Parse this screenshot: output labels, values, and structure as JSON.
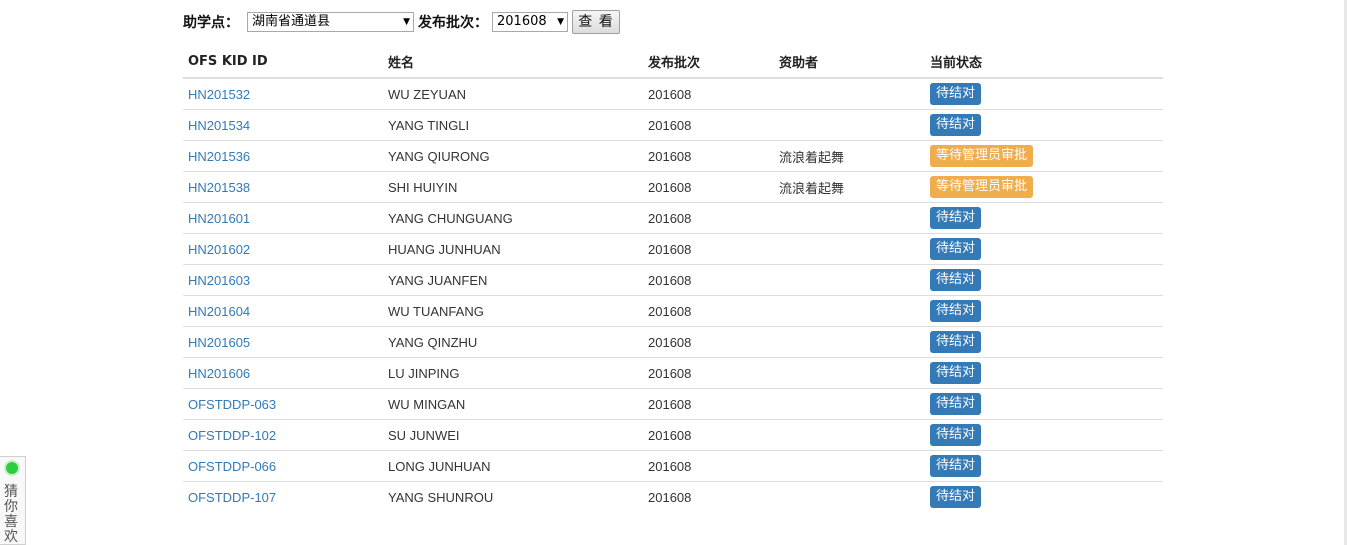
{
  "filters": {
    "site_label": "助学点：",
    "site_value": "湖南省通道县",
    "batch_label": "发布批次：",
    "batch_value": "201608",
    "view_button": "查 看"
  },
  "table": {
    "headers": [
      "OFS KID ID",
      "姓名",
      "发布批次",
      "资助者",
      "当前状态"
    ],
    "rows": [
      {
        "id": "HN201532",
        "name": "WU ZEYUAN",
        "batch": "201608",
        "sponsor": "",
        "status": "待结对",
        "status_kind": "primary"
      },
      {
        "id": "HN201534",
        "name": "YANG TINGLI",
        "batch": "201608",
        "sponsor": "",
        "status": "待结对",
        "status_kind": "primary"
      },
      {
        "id": "HN201536",
        "name": "YANG QIURONG",
        "batch": "201608",
        "sponsor": "流浪着起舞",
        "status": "等待管理员审批",
        "status_kind": "warning"
      },
      {
        "id": "HN201538",
        "name": "SHI HUIYIN",
        "batch": "201608",
        "sponsor": "流浪着起舞",
        "status": "等待管理员审批",
        "status_kind": "warning"
      },
      {
        "id": "HN201601",
        "name": "YANG CHUNGUANG",
        "batch": "201608",
        "sponsor": "",
        "status": "待结对",
        "status_kind": "primary"
      },
      {
        "id": "HN201602",
        "name": "HUANG JUNHUAN",
        "batch": "201608",
        "sponsor": "",
        "status": "待结对",
        "status_kind": "primary"
      },
      {
        "id": "HN201603",
        "name": "YANG JUANFEN",
        "batch": "201608",
        "sponsor": "",
        "status": "待结对",
        "status_kind": "primary"
      },
      {
        "id": "HN201604",
        "name": "WU TUANFANG",
        "batch": "201608",
        "sponsor": "",
        "status": "待结对",
        "status_kind": "primary"
      },
      {
        "id": "HN201605",
        "name": "YANG QINZHU",
        "batch": "201608",
        "sponsor": "",
        "status": "待结对",
        "status_kind": "primary"
      },
      {
        "id": "HN201606",
        "name": "LU JINPING",
        "batch": "201608",
        "sponsor": "",
        "status": "待结对",
        "status_kind": "primary"
      },
      {
        "id": "OFSTDDP-063",
        "name": "WU MINGAN",
        "batch": "201608",
        "sponsor": "",
        "status": "待结对",
        "status_kind": "primary"
      },
      {
        "id": "OFSTDDP-102",
        "name": "SU JUNWEI",
        "batch": "201608",
        "sponsor": "",
        "status": "待结对",
        "status_kind": "primary"
      },
      {
        "id": "OFSTDDP-066",
        "name": "LONG JUNHUAN",
        "batch": "201608",
        "sponsor": "",
        "status": "待结对",
        "status_kind": "primary"
      },
      {
        "id": "OFSTDDP-107",
        "name": "YANG SHUNROU",
        "batch": "201608",
        "sponsor": "",
        "status": "待结对",
        "status_kind": "primary"
      }
    ]
  },
  "side_widget": {
    "icon": "green-dot-icon",
    "text": "猜你喜欢"
  },
  "colors": {
    "link": "#337ab7",
    "badge_primary": "#337ab7",
    "badge_warning": "#f0ad4e"
  }
}
